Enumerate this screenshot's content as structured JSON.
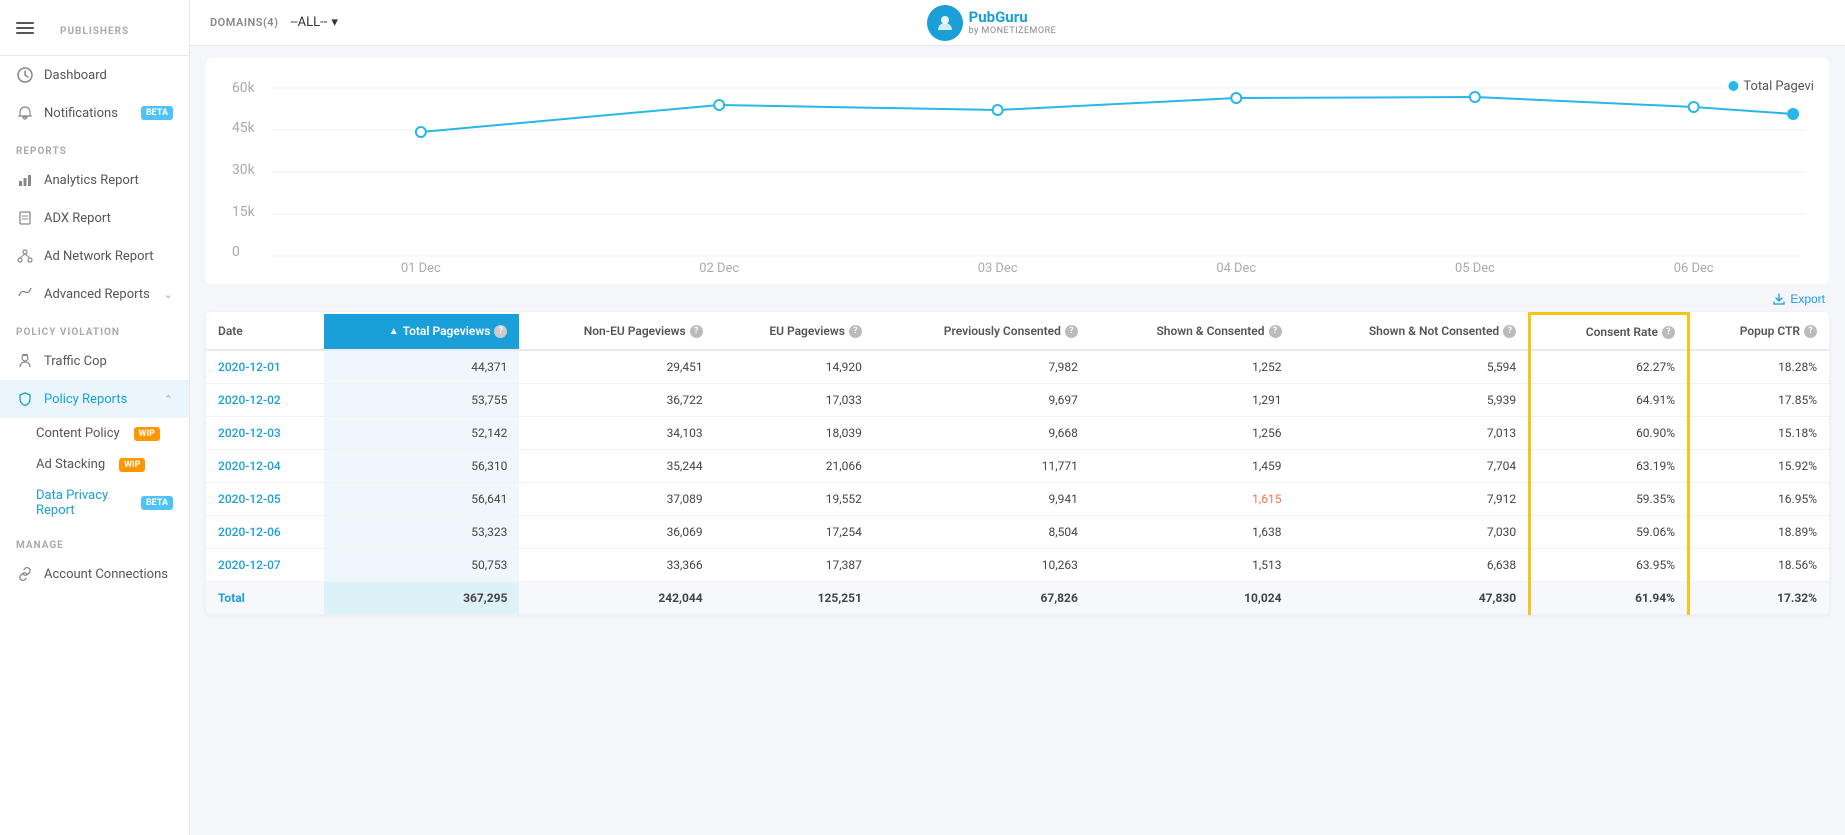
{
  "sidebar": {
    "publishers_label": "PUBLISHERS",
    "nav_items": [
      {
        "id": "dashboard",
        "label": "Dashboard",
        "icon": "circle-check"
      },
      {
        "id": "notifications",
        "label": "Notifications",
        "badge": "BETA",
        "badge_type": "beta",
        "icon": "bell"
      }
    ],
    "reports_label": "REPORTS",
    "report_items": [
      {
        "id": "analytics",
        "label": "Analytics Report",
        "icon": "bar-chart"
      },
      {
        "id": "adx",
        "label": "ADX Report",
        "icon": "file"
      },
      {
        "id": "adnetwork",
        "label": "Ad Network Report",
        "icon": "network"
      },
      {
        "id": "advanced",
        "label": "Advanced Reports",
        "icon": "chart",
        "has_chevron": true
      }
    ],
    "policy_label": "POLICY VIOLATION",
    "policy_items": [
      {
        "id": "trafficcop",
        "label": "Traffic Cop",
        "icon": "cop"
      }
    ],
    "policy_reports_label": "",
    "policy_reports": {
      "label": "Policy Reports",
      "icon": "shield",
      "expanded": true,
      "sub_items": [
        {
          "id": "contentpolicy",
          "label": "Content Policy",
          "badge": "WIP",
          "badge_type": "wip"
        },
        {
          "id": "adstacking",
          "label": "Ad Stacking",
          "badge": "WIP",
          "badge_type": "wip"
        },
        {
          "id": "dataprivacy",
          "label": "Data Privacy Report",
          "badge": "BETA",
          "badge_type": "beta",
          "active": true
        }
      ]
    },
    "manage_label": "MANAGE",
    "manage_items": [
      {
        "id": "account",
        "label": "Account Connections",
        "icon": "link"
      }
    ]
  },
  "topbar": {
    "domains_label": "DOMAINS(4)",
    "domains_value": "--ALL--",
    "logo_text": "PubGuru",
    "logo_sub": "by MONETIZEMORE"
  },
  "chart": {
    "legend": "Total Pageviews",
    "y_labels": [
      "60k",
      "45k",
      "30k",
      "15k",
      "0"
    ],
    "x_labels": [
      "01 Dec",
      "02 Dec",
      "03 Dec",
      "04 Dec",
      "05 Dec",
      "06 Dec"
    ],
    "data_points": [
      44371,
      53755,
      52142,
      56310,
      56641,
      53323,
      50753
    ]
  },
  "table": {
    "export_label": "Export",
    "columns": [
      {
        "id": "date",
        "label": "Date"
      },
      {
        "id": "total_pageviews",
        "label": "Total Pageviews",
        "highlighted": true
      },
      {
        "id": "non_eu",
        "label": "Non-EU Pageviews"
      },
      {
        "id": "eu",
        "label": "EU Pageviews"
      },
      {
        "id": "prev_consented",
        "label": "Previously Consented"
      },
      {
        "id": "shown_consented",
        "label": "Shown & Consented"
      },
      {
        "id": "shown_not_consented",
        "label": "Shown & Not Consented"
      },
      {
        "id": "consent_rate",
        "label": "Consent Rate",
        "highlighted_border": true
      },
      {
        "id": "popup_ctr",
        "label": "Popup CTR"
      }
    ],
    "rows": [
      {
        "date": "2020-12-01",
        "total_pageviews": "44,371",
        "non_eu": "29,451",
        "eu": "14,920",
        "prev_consented": "7,982",
        "shown_consented": "1,252",
        "shown_not_consented": "5,594",
        "consent_rate": "62.27%",
        "popup_ctr": "18.28%"
      },
      {
        "date": "2020-12-02",
        "total_pageviews": "53,755",
        "non_eu": "36,722",
        "eu": "17,033",
        "prev_consented": "9,697",
        "shown_consented": "1,291",
        "shown_not_consented": "5,939",
        "consent_rate": "64.91%",
        "popup_ctr": "17.85%"
      },
      {
        "date": "2020-12-03",
        "total_pageviews": "52,142",
        "non_eu": "34,103",
        "eu": "18,039",
        "prev_consented": "9,668",
        "shown_consented": "1,256",
        "shown_not_consented": "7,013",
        "consent_rate": "60.90%",
        "popup_ctr": "15.18%"
      },
      {
        "date": "2020-12-04",
        "total_pageviews": "56,310",
        "non_eu": "35,244",
        "eu": "21,066",
        "prev_consented": "11,771",
        "shown_consented": "1,459",
        "shown_not_consented": "7,704",
        "consent_rate": "63.19%",
        "popup_ctr": "15.92%"
      },
      {
        "date": "2020-12-05",
        "total_pageviews": "56,641",
        "non_eu": "37,089",
        "eu": "19,552",
        "prev_consented": "9,941",
        "shown_consented": "1,615",
        "shown_not_consented": "7,912",
        "consent_rate": "59.35%",
        "popup_ctr": "16.95%",
        "shown_consented_orange": true
      },
      {
        "date": "2020-12-06",
        "total_pageviews": "53,323",
        "non_eu": "36,069",
        "eu": "17,254",
        "prev_consented": "8,504",
        "shown_consented": "1,638",
        "shown_not_consented": "7,030",
        "consent_rate": "59.06%",
        "popup_ctr": "18.89%"
      },
      {
        "date": "2020-12-07",
        "total_pageviews": "50,753",
        "non_eu": "33,366",
        "eu": "17,387",
        "prev_consented": "10,263",
        "shown_consented": "1,513",
        "shown_not_consented": "6,638",
        "consent_rate": "63.95%",
        "popup_ctr": "18.56%"
      },
      {
        "date": "Total",
        "total_pageviews": "367,295",
        "non_eu": "242,044",
        "eu": "125,251",
        "prev_consented": "67,826",
        "shown_consented": "10,024",
        "shown_not_consented": "47,830",
        "consent_rate": "61.94%",
        "popup_ctr": "17.32%",
        "is_total": true
      }
    ]
  }
}
